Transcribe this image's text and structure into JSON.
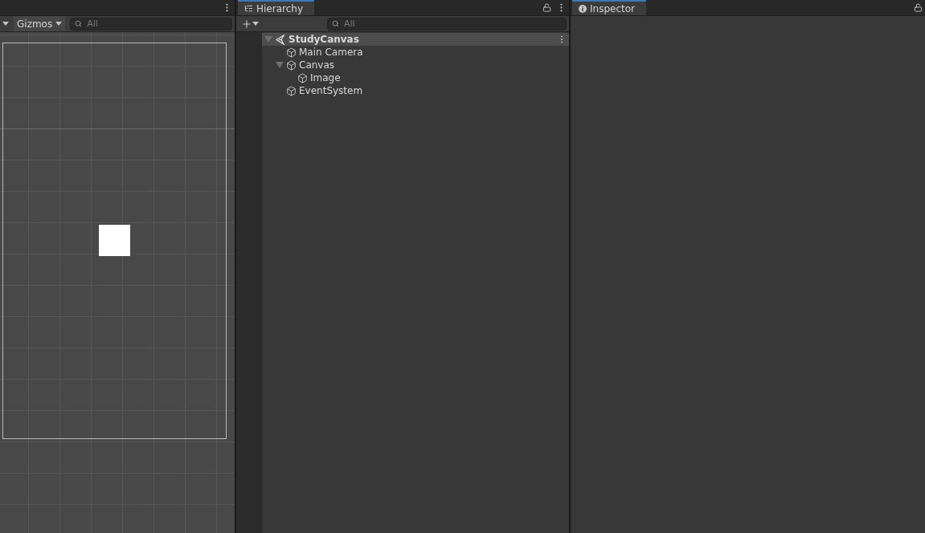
{
  "scene_panel": {
    "toolbar": {
      "gizmos": "Gizmos",
      "search": {
        "placeholder": "All"
      }
    }
  },
  "hierarchy": {
    "tab": {
      "label": "Hierarchy",
      "selected": true
    },
    "search": {
      "placeholder": "All"
    },
    "scene": {
      "name": "StudyCanvas",
      "expanded": true,
      "children": [
        {
          "name": "Main Camera"
        },
        {
          "name": "Canvas",
          "expanded": true,
          "children": [
            {
              "name": "Image"
            }
          ]
        },
        {
          "name": "EventSystem"
        }
      ]
    }
  },
  "inspector": {
    "tab": {
      "label": "Inspector",
      "selected": true
    }
  }
}
